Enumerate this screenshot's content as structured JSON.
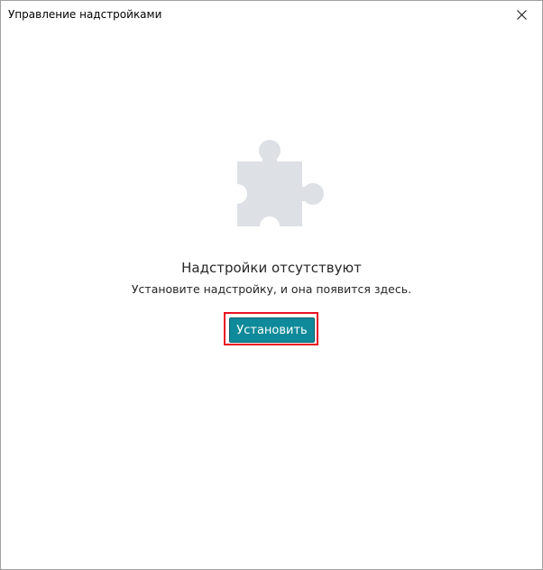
{
  "window": {
    "title": "Управление надстройками",
    "close_icon": "close-icon"
  },
  "empty_state": {
    "icon": "puzzle-piece-icon",
    "heading": "Надстройки отсутствуют",
    "description": "Установите надстройку, и она появится здесь.",
    "install_label": "Установить"
  },
  "colors": {
    "accent": "#0e8a9a",
    "focus_outline": "#e81123",
    "icon_fill": "#dde1e6"
  }
}
